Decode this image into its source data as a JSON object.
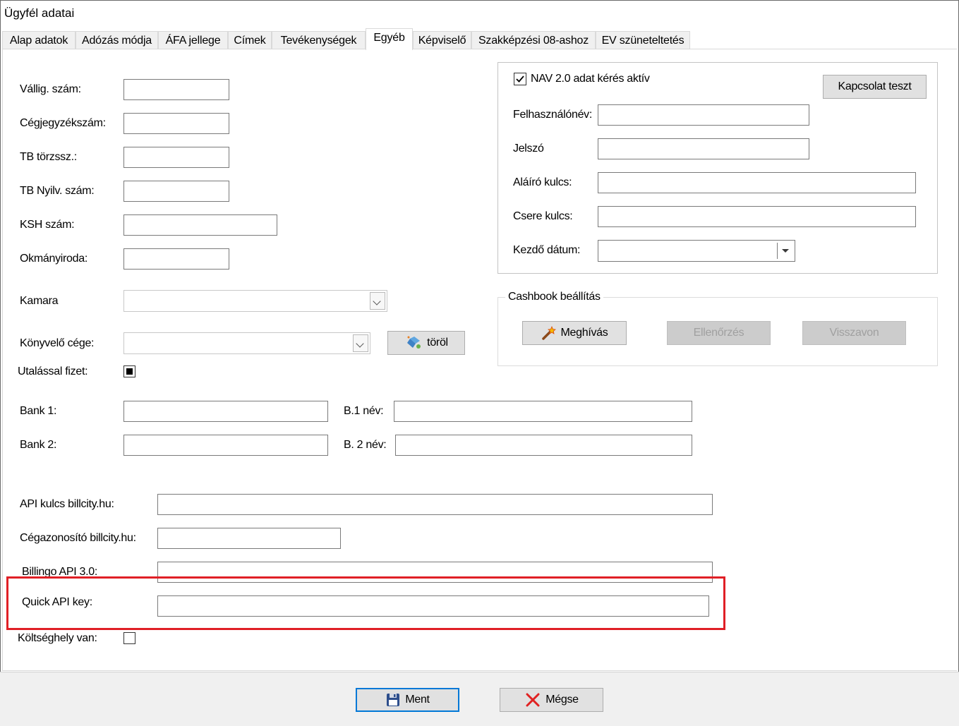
{
  "window": {
    "title": "Ügyfél adatai"
  },
  "tabs": [
    {
      "label": "Alap adatok"
    },
    {
      "label": "Adózás módja"
    },
    {
      "label": "ÁFA jellege"
    },
    {
      "label": "Címek"
    },
    {
      "label": "Tevékenységek"
    },
    {
      "label": "Egyéb"
    },
    {
      "label": "Képviselő"
    },
    {
      "label": "Szakképzési 08-ashoz"
    },
    {
      "label": "EV szüneteltetés"
    }
  ],
  "active_tab": "Egyéb",
  "left": {
    "vallig_label": "Vállig. szám:",
    "vallig_value": "",
    "cegjegyzek_label": "Cégjegyzékszám:",
    "cegjegyzek_value": "",
    "tb_torzs_label": "TB törzssz.:",
    "tb_torzs_value": "",
    "tb_nyilv_label": "TB Nyilv. szám:",
    "tb_nyilv_value": "",
    "ksh_label": "KSH szám:",
    "ksh_value": "",
    "okmany_label": "Okmányiroda:",
    "okmany_value": "",
    "kamara_label": "Kamara",
    "kamara_value": "",
    "konyvelo_label": "Könyvelő cége:",
    "konyvelo_value": "",
    "torol_label": "töröl",
    "utalas_label": "Utalással fizet:",
    "bank1_label": "Bank 1:",
    "bank1_value": "",
    "b1nev_label": "B.1 név:",
    "b1nev_value": "",
    "bank2_label": "Bank 2:",
    "bank2_value": "",
    "b2nev_label": "B. 2 név:",
    "b2nev_value": "",
    "api_billcity_label": "API kulcs billcity.hu:",
    "api_billcity_value": "",
    "ceg_billcity_label": "Cégazonosító billcity.hu:",
    "ceg_billcity_value": "",
    "billingo_label": "Billingo API 3.0:",
    "billingo_value": "",
    "quick_label": "Quick API key:",
    "quick_value": "",
    "koltseg_label": "Költséghely van:"
  },
  "nav": {
    "checkbox_label": "NAV 2.0 adat kérés aktív",
    "test_button": "Kapcsolat teszt",
    "user_label": "Felhasználónév:",
    "user_value": "",
    "password_label": "Jelszó",
    "password_value": "",
    "sign_key_label": "Aláíró kulcs:",
    "sign_key_value": "",
    "exchange_key_label": "Csere kulcs:",
    "exchange_key_value": "",
    "start_date_label": "Kezdő dátum:",
    "start_date_value": ""
  },
  "cashbook": {
    "title": "Cashbook beállítás",
    "invite_button": "Meghívás",
    "check_button": "Ellenőrzés",
    "revoke_button": "Visszavon"
  },
  "footer": {
    "save_button": "Ment",
    "cancel_button": "Mégse"
  },
  "colors": {
    "highlight": "#e01f26",
    "default_button_border": "#0078d7"
  }
}
